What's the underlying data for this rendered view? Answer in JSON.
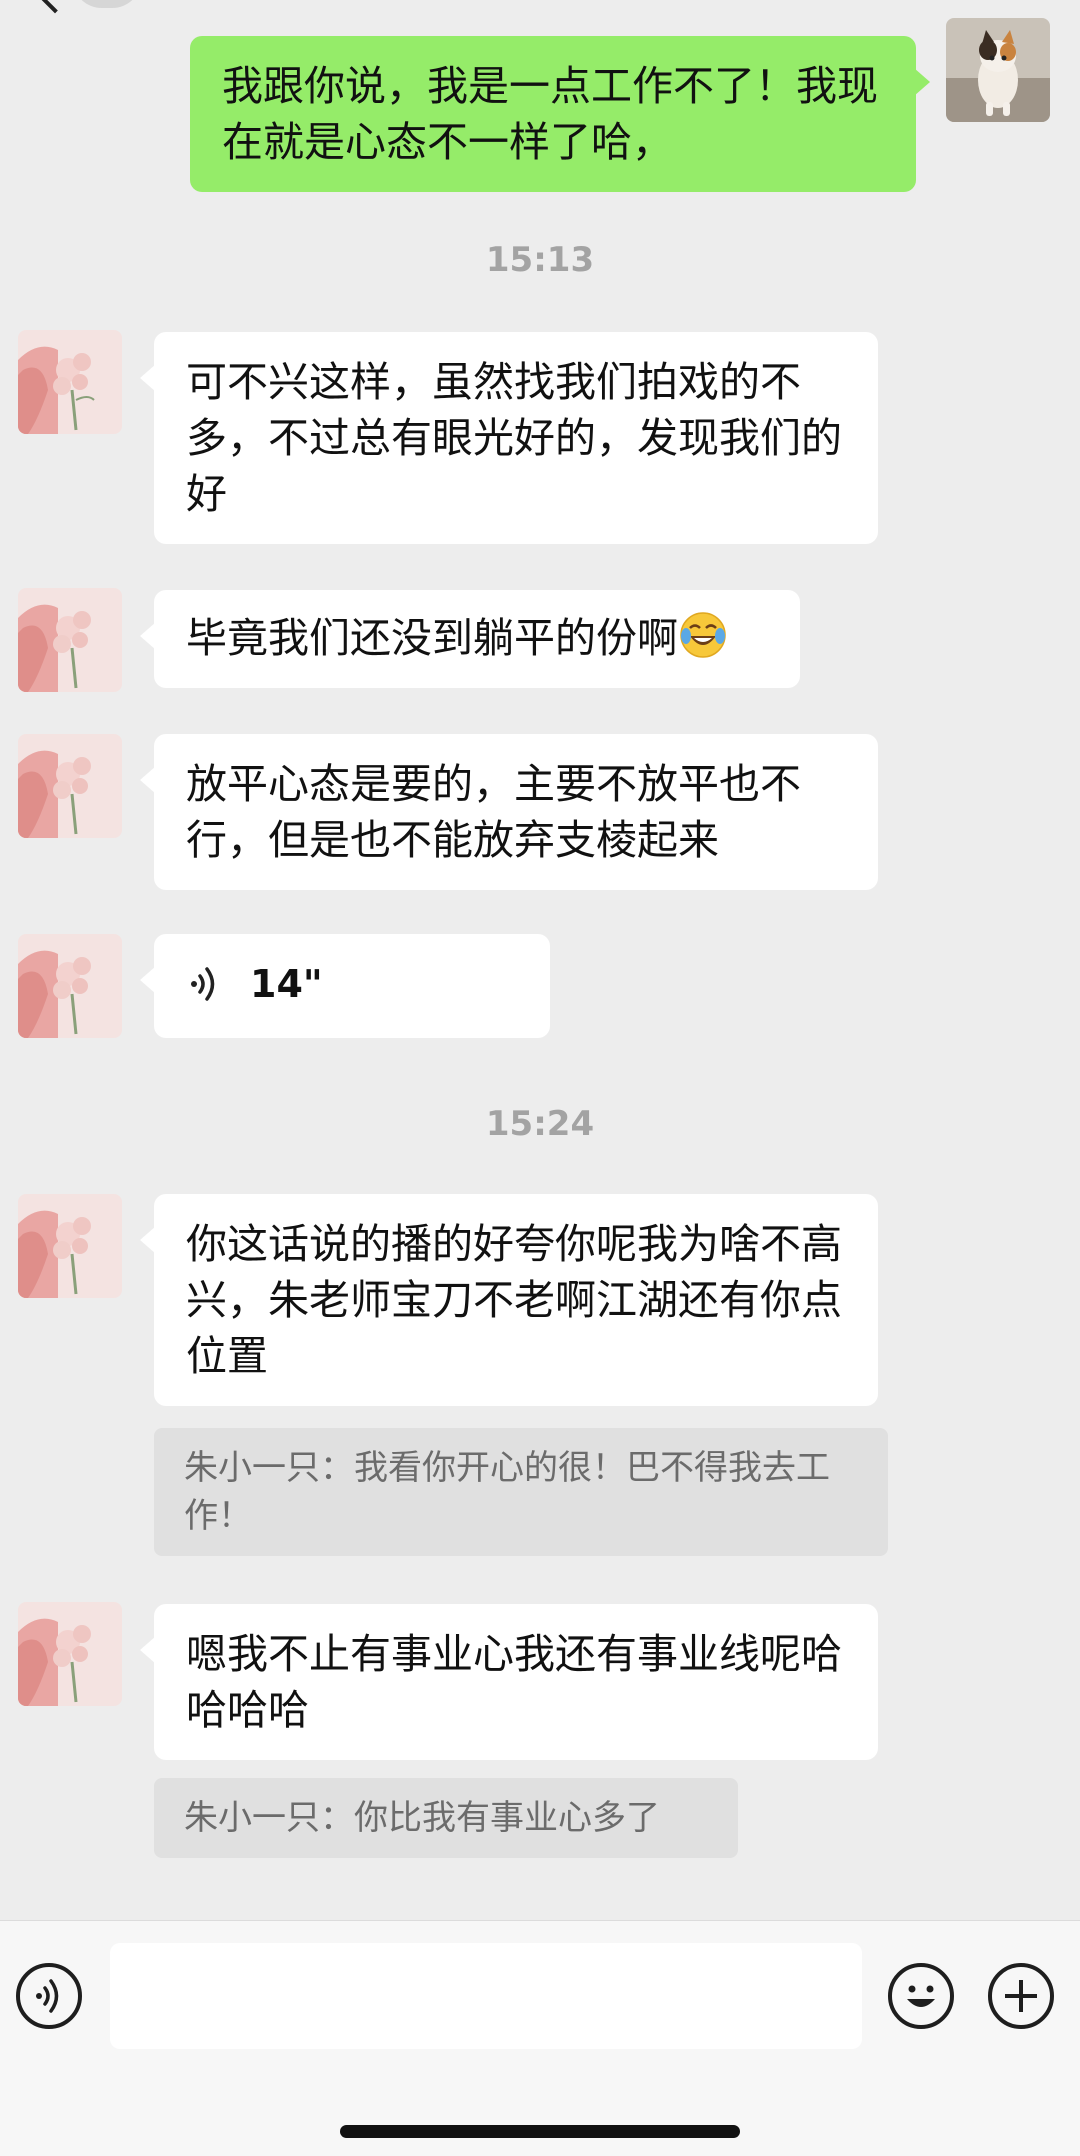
{
  "header": {
    "title": "....."
  },
  "messages": {
    "m0": {
      "text": "我跟你说，我是一点工作不了！我现在就是心态不一样了哈，"
    },
    "t1": "15:13",
    "m1": {
      "text": "可不兴这样，虽然找我们拍戏的不多，不过总有眼光好的，发现我们的好"
    },
    "m2": {
      "text": "毕竟我们还没到躺平的份啊",
      "emoji": "crying-laughing-emoji"
    },
    "m3": {
      "text": "放平心态是要的，主要不放平也不行，但是也不能放弃支棱起来"
    },
    "m4": {
      "voice_duration": "14\""
    },
    "t2": "15:24",
    "m5": {
      "text": "你这话说的播的好夸你呢我为啥不高兴，朱老师宝刀不老啊江湖还有你点位置"
    },
    "q5": {
      "text": "朱小一只：我看你开心的很！巴不得我去工作！"
    },
    "m6": {
      "text": "嗯我不止有事业心我还有事业线呢哈哈哈哈"
    },
    "q6": {
      "text": "朱小一只：你比我有事业心多了"
    }
  },
  "input_bar": {
    "voice_icon": "voice-icon",
    "emoji_icon": "smile-icon",
    "more_icon": "plus-icon",
    "message_value": ""
  },
  "colors": {
    "background": "#ededed",
    "self_bubble": "#95ec69",
    "other_bubble": "#ffffff",
    "quote_bg": "#e0e0e0",
    "timestamp": "#a3a3a3"
  }
}
